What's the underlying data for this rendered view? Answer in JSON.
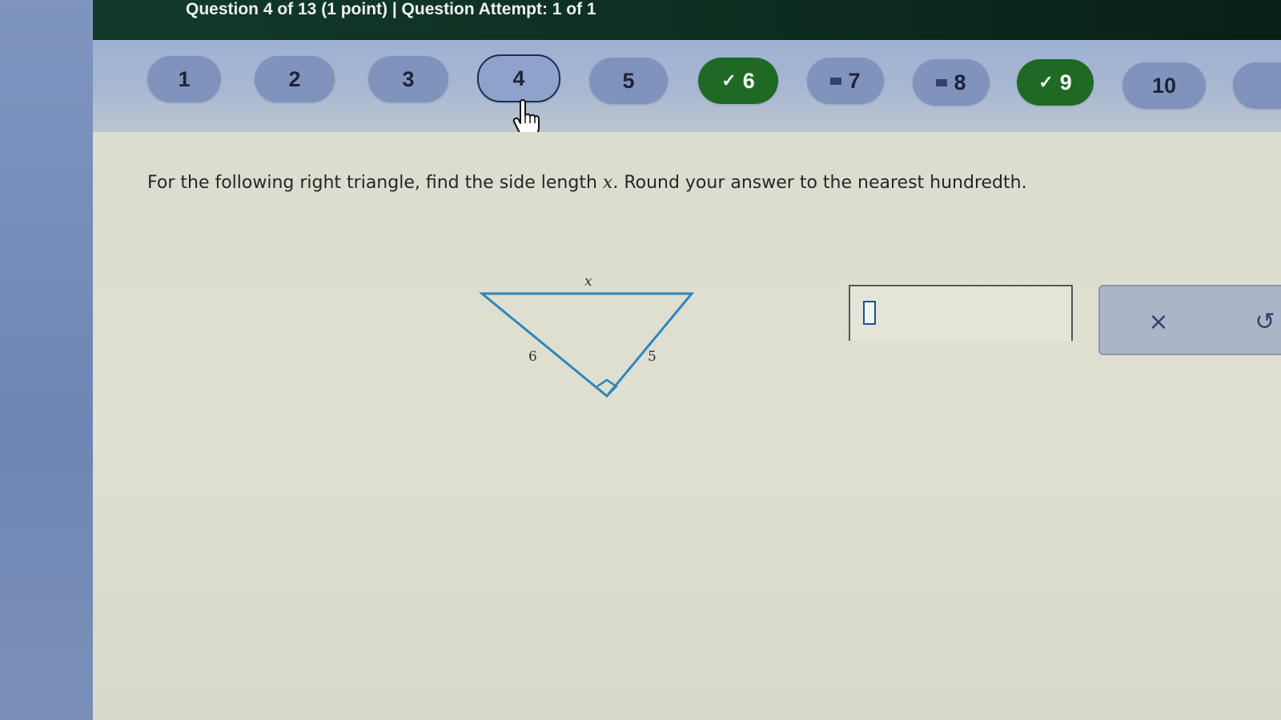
{
  "header": {
    "title": "Question 4 of 13 (1 point)  |  Question Attempt: 1 of 1"
  },
  "question_nav": {
    "items": [
      {
        "label": "1",
        "state": "unanswered"
      },
      {
        "label": "2",
        "state": "unanswered"
      },
      {
        "label": "3",
        "state": "unanswered"
      },
      {
        "label": "4",
        "state": "current"
      },
      {
        "label": "5",
        "state": "unanswered"
      },
      {
        "label": "6",
        "state": "correct"
      },
      {
        "label": "7",
        "state": "flagged"
      },
      {
        "label": "8",
        "state": "flagged"
      },
      {
        "label": "9",
        "state": "correct"
      },
      {
        "label": "10",
        "state": "unanswered"
      }
    ],
    "check_glyph": "✓"
  },
  "question": {
    "text_before": "For the following right triangle, find the side length ",
    "variable": "x",
    "text_after": ". Round your answer to the nearest hundredth."
  },
  "figure": {
    "label_top": "x",
    "label_left": "6",
    "label_right": "5"
  },
  "answer": {
    "value": ""
  },
  "tools": {
    "clear_icon": "×",
    "undo_icon": "↺"
  },
  "colors": {
    "header_bg": "#0d2c1f",
    "correct_pill": "#1e6a24",
    "triangle_stroke": "#2f86b8"
  }
}
